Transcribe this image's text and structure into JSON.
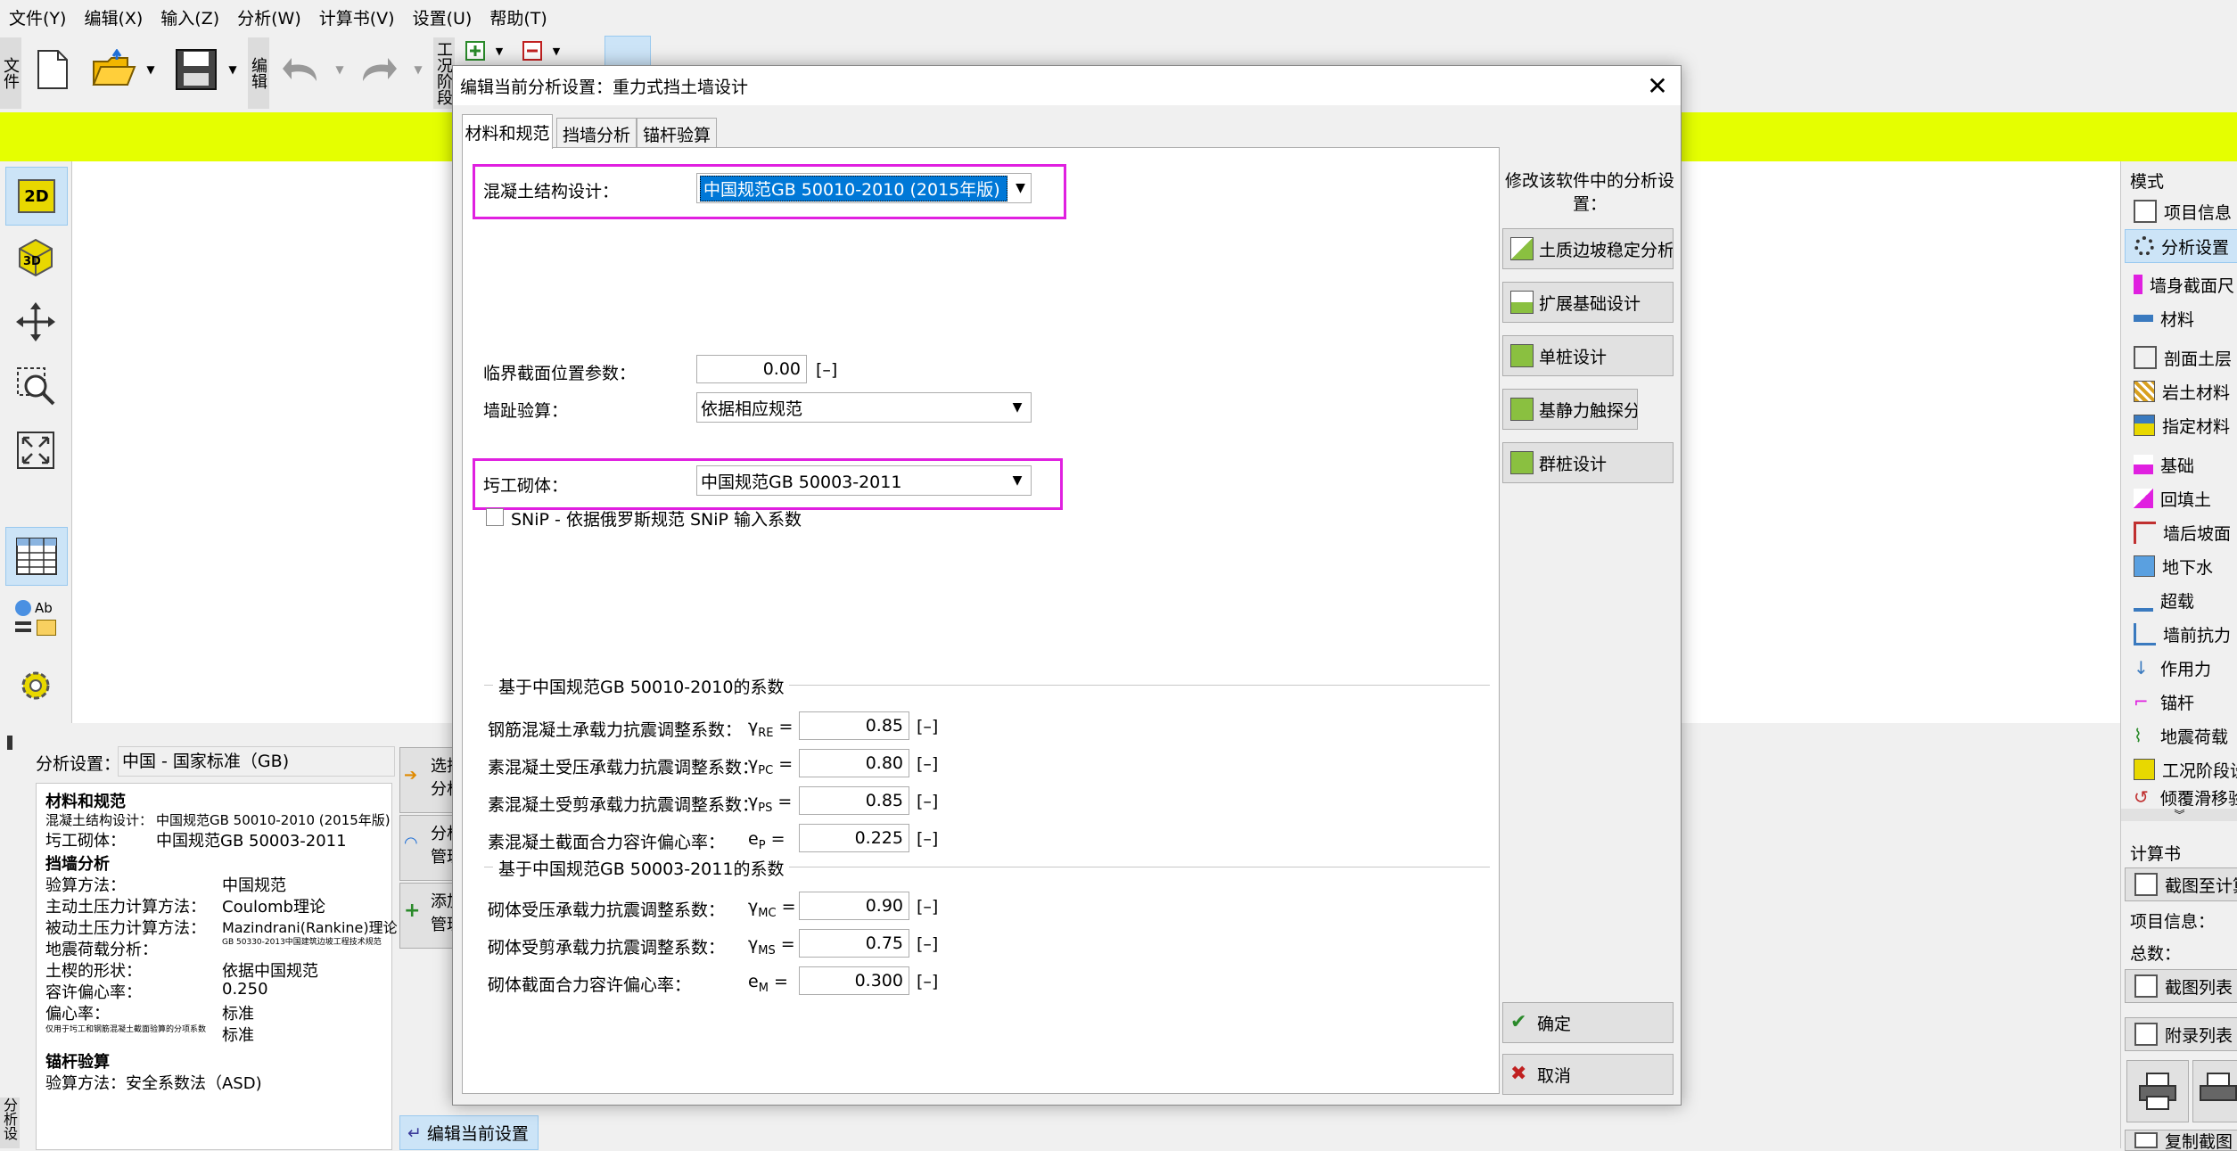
{
  "menu": [
    "文件(Y)",
    "编辑(X)",
    "输入(Z)",
    "分析(W)",
    "计算书(V)",
    "设置(U)",
    "帮助(T)"
  ],
  "toolbar": {
    "file_label": "文件",
    "edit_label": "编辑",
    "stage_label": "工况阶段"
  },
  "left_tools": {
    "two_d": "2D",
    "three_d": "3D",
    "ab": "Ab"
  },
  "right_panel": {
    "mode_header": "模式",
    "items": [
      "项目信息",
      "分析设置",
      "墙身截面尺",
      "材料",
      "剖面土层",
      "岩土材料",
      "指定材料",
      "基础",
      "回填土",
      "墙后坡面",
      "地下水",
      "超载",
      "墙前抗力",
      "作用力",
      "锚杆",
      "地震荷载",
      "工况阶段设",
      "倾覆滑移验"
    ],
    "report_header": "计算书",
    "report_items": [
      "截图至计算",
      "项目信息：",
      "总数：",
      "截图列表",
      "附录列表",
      "复制截图"
    ]
  },
  "bottom": {
    "analysis_setting_label": "分析设置：",
    "analysis_setting_value": "中国 - 国家标准（GB)",
    "summary": {
      "h1": "材料和规范",
      "r1": "混凝土结构设计：",
      "r1v": "中国规范GB 50010-2010 (2015年版)",
      "r2": "圬工砌体：",
      "r2v": "中国规范GB 50003-2011",
      "h2": "挡墙分析",
      "rows": [
        {
          "k": "验算方法：",
          "v": "中国规范"
        },
        {
          "k": "主动土压力计算方法：",
          "v": "Coulomb理论"
        },
        {
          "k": "被动土压力计算方法：",
          "v": "Mazindrani(Rankine)理论"
        },
        {
          "k": "地震荷载分析：",
          "v": "GB 50330-2013中国建筑边坡工程技术规范"
        },
        {
          "k": "土楔的形状：",
          "v": "依据中国规范"
        },
        {
          "k": "容许偏心率：",
          "v": "0.250"
        },
        {
          "k": "偏心率：",
          "v": "标准"
        },
        {
          "k": "仅用于圬工和钢筋混凝土截面验算的分项系数",
          "v": "标准"
        }
      ],
      "h3": "锚杆验算",
      "r3": "验算方法：安全系数法（ASD)"
    },
    "side_buttons": [
      "选择分析",
      "分析管理",
      "添加管理"
    ],
    "edit_current": "编辑当前设置"
  },
  "dialog": {
    "title": "编辑当前分析设置：重力式挡土墙设计",
    "tabs": [
      "材料和规范",
      "挡墙分析",
      "锚杆验算"
    ],
    "concrete_label": "混凝土结构设计：",
    "concrete_value": "中国规范GB 50010-2010 (2015年版)",
    "critical_label": "临界截面位置参数：",
    "critical_value": "0.00",
    "critical_unit": "[–]",
    "toe_label": "墙趾验算：",
    "toe_value": "依据相应规范",
    "masonry_label": "圬工砌体：",
    "masonry_value": "中国规范GB 50003-2011",
    "snip_label": "SNiP - 依据俄罗斯规范 SNiP 输入系数",
    "group1": "基于中国规范GB 50010-2010的系数",
    "group2": "基于中国规范GB 50003-2011的系数",
    "coef1": [
      {
        "label": "钢筋混凝土承载力抗震调整系数：",
        "sym": "γ",
        "sub": "RE",
        "value": "0.85"
      },
      {
        "label": "素混凝土受压承载力抗震调整系数：",
        "sym": "γ",
        "sub": "PC",
        "value": "0.80"
      },
      {
        "label": "素混凝土受剪承载力抗震调整系数：",
        "sym": "γ",
        "sub": "PS",
        "value": "0.85"
      },
      {
        "label": "素混凝土截面合力容许偏心率：",
        "sym": "e",
        "sub": "P",
        "value": "0.225"
      }
    ],
    "coef2": [
      {
        "label": "砌体受压承载力抗震调整系数：",
        "sym": "γ",
        "sub": "MC",
        "value": "0.90"
      },
      {
        "label": "砌体受剪承载力抗震调整系数：",
        "sym": "γ",
        "sub": "MS",
        "value": "0.75"
      },
      {
        "label": "砌体截面合力容许偏心率：",
        "sym": "e",
        "sub": "M",
        "value": "0.300"
      }
    ],
    "unit": "[–]",
    "eq": "=",
    "right_note": "修改该软件中的分析设置：",
    "right_buttons": [
      "土质边坡稳定分析",
      "扩展基础设计",
      "单桩设计",
      "基静力触探分",
      "群桩设计"
    ],
    "ok": "确定",
    "cancel": "取消"
  },
  "colors": {
    "highlight": "#e020e0",
    "yellow_bar": "#e5ff00",
    "selection": "#0078d7"
  }
}
